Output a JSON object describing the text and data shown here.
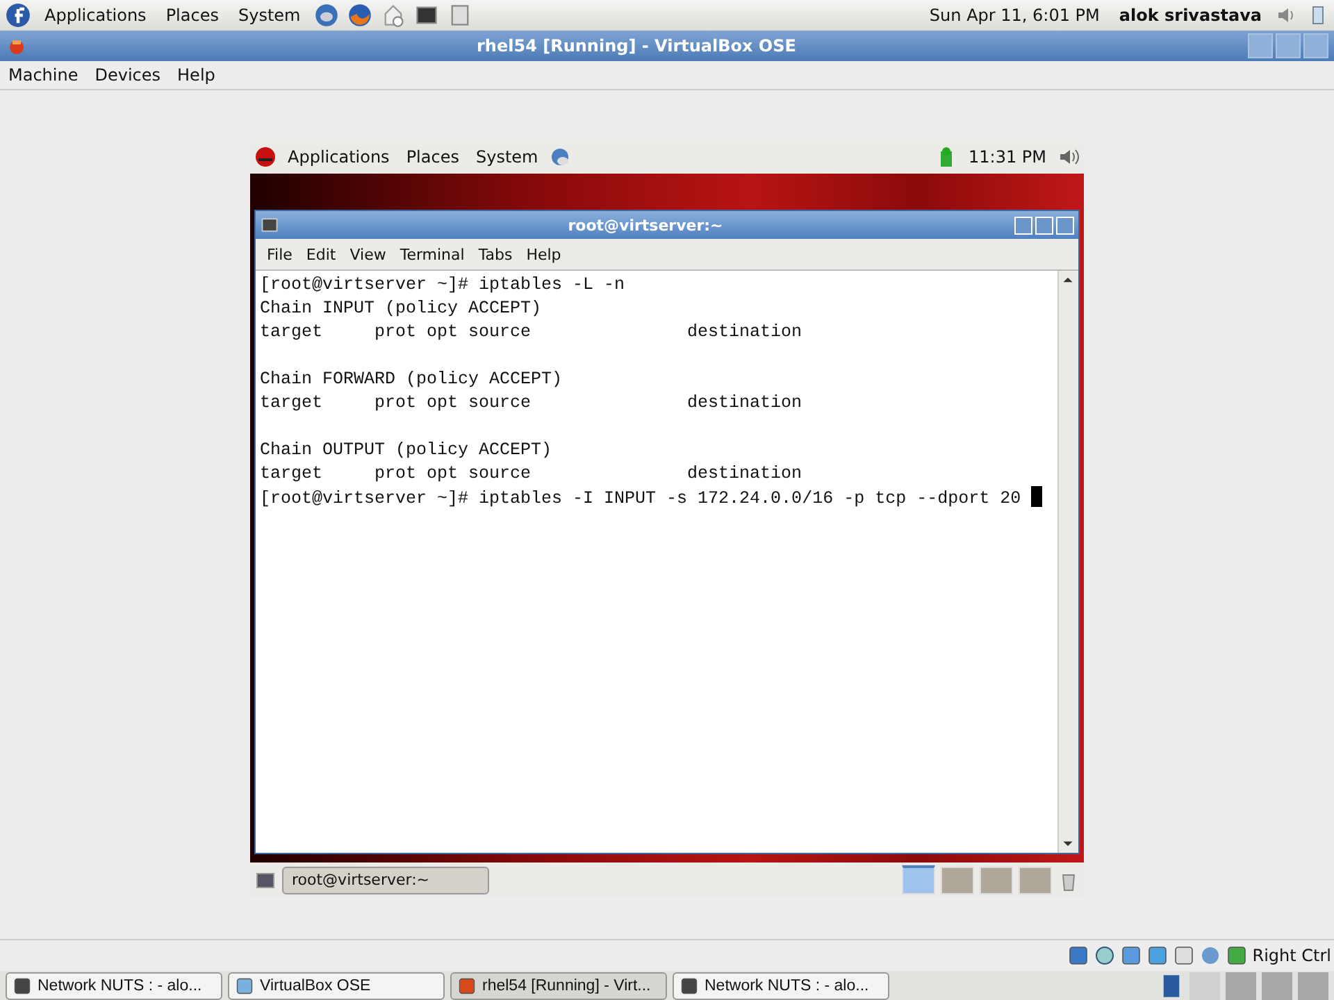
{
  "host_panel": {
    "menus": [
      "Applications",
      "Places",
      "System"
    ],
    "clock": "Sun Apr 11,  6:01 PM",
    "user": "alok srivastava"
  },
  "vbox_window": {
    "title": "rhel54 [Running] - VirtualBox OSE",
    "menus": [
      "Machine",
      "Devices",
      "Help"
    ],
    "guest": {
      "panel": {
        "menus": [
          "Applications",
          "Places",
          "System"
        ],
        "clock": "11:31 PM"
      },
      "terminal": {
        "title": "root@virtserver:~",
        "menus": [
          "File",
          "Edit",
          "View",
          "Terminal",
          "Tabs",
          "Help"
        ],
        "blocks": [
          [
            "[root@virtserver ~]# iptables -L -n",
            "Chain INPUT (policy ACCEPT)",
            "target     prot opt source               destination"
          ],
          [
            "Chain FORWARD (policy ACCEPT)",
            "target     prot opt source               destination"
          ],
          [
            "Chain OUTPUT (policy ACCEPT)",
            "target     prot opt source               destination",
            "[root@virtserver ~]# iptables -I INPUT -s 172.24.0.0/16 -p tcp --dport 20 "
          ]
        ]
      },
      "taskbar": {
        "task": {
          "label": "root@virtserver:~",
          "selected": true
        },
        "workspaces": [
          {
            "selected": true
          },
          {
            "selected": false
          },
          {
            "selected": false
          },
          {
            "selected": false
          }
        ]
      }
    },
    "status_bar": {
      "host_key": "Right Ctrl"
    }
  },
  "host_taskbar": {
    "tasks": [
      {
        "label": "Network NUTS :  - alo...",
        "selected": false
      },
      {
        "label": "VirtualBox OSE",
        "selected": false
      },
      {
        "label": "rhel54 [Running] - Virt...",
        "selected": true
      },
      {
        "label": "Network NUTS :  - alo...",
        "selected": false
      }
    ],
    "workspaces": [
      {
        "selected": true
      },
      {
        "selected": false
      },
      {
        "selected": false
      },
      {
        "selected": false
      }
    ]
  }
}
